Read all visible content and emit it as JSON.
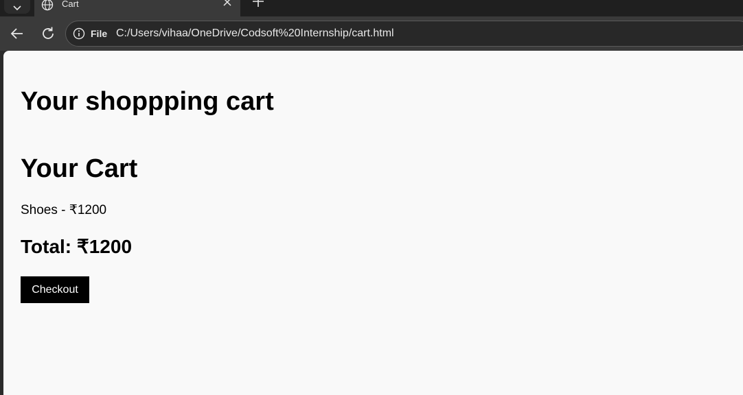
{
  "browser": {
    "tab_title": "Cart",
    "url_scheme_label": "File",
    "url": "C:/Users/vihaa/OneDrive/Codsoft%20Internship/cart.html",
    "icons": [
      "tab-search-icon",
      "globe-icon",
      "close-icon",
      "plus-icon",
      "back-arrow-icon",
      "reload-icon",
      "info-icon"
    ]
  },
  "page": {
    "heading": "Your shoppping cart",
    "cart_heading": "Your Cart",
    "items": [
      {
        "text": "Shoes - ₹1200"
      }
    ],
    "total": "Total: ₹1200",
    "checkout_label": "Checkout"
  },
  "colors": {
    "page_background": "#f9f9f9",
    "button_background": "#000000",
    "button_text": "#ffffff",
    "browser_chrome": "#3a3a3a"
  }
}
